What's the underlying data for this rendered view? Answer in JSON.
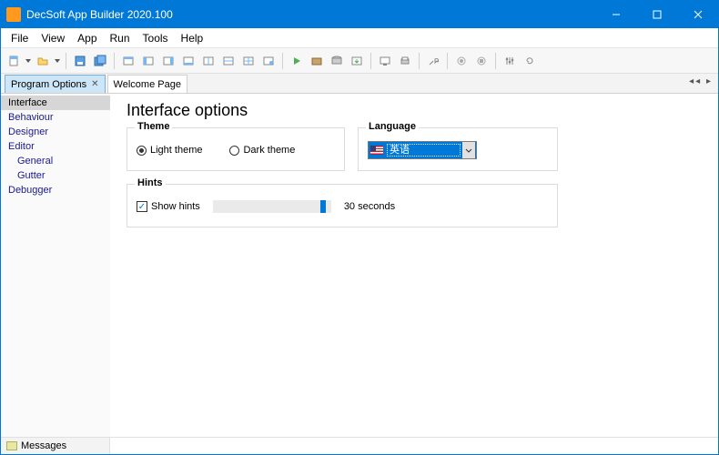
{
  "title": "DecSoft App Builder 2020.100",
  "menubar": [
    "File",
    "View",
    "App",
    "Run",
    "Tools",
    "Help"
  ],
  "tabs": [
    {
      "label": "Program Options",
      "active": true,
      "closeable": true
    },
    {
      "label": "Welcome Page",
      "active": false,
      "closeable": false
    }
  ],
  "sidebar": [
    {
      "label": "Interface",
      "selected": true,
      "indent": false
    },
    {
      "label": "Behaviour",
      "selected": false,
      "indent": false
    },
    {
      "label": "Designer",
      "selected": false,
      "indent": false
    },
    {
      "label": "Editor",
      "selected": false,
      "indent": false
    },
    {
      "label": "General",
      "selected": false,
      "indent": true
    },
    {
      "label": "Gutter",
      "selected": false,
      "indent": true
    },
    {
      "label": "Debugger",
      "selected": false,
      "indent": false
    }
  ],
  "page": {
    "title": "Interface options",
    "theme": {
      "legend": "Theme",
      "light": "Light theme",
      "dark": "Dark theme",
      "selected": "light"
    },
    "language": {
      "legend": "Language",
      "value": "英语"
    },
    "hints": {
      "legend": "Hints",
      "show_label": "Show hints",
      "show_checked": true,
      "slider_value": 30,
      "slider_max": 32,
      "value_label": "30 seconds"
    }
  },
  "statusbar": {
    "messages": "Messages"
  },
  "colors": {
    "accent": "#0078d7"
  }
}
